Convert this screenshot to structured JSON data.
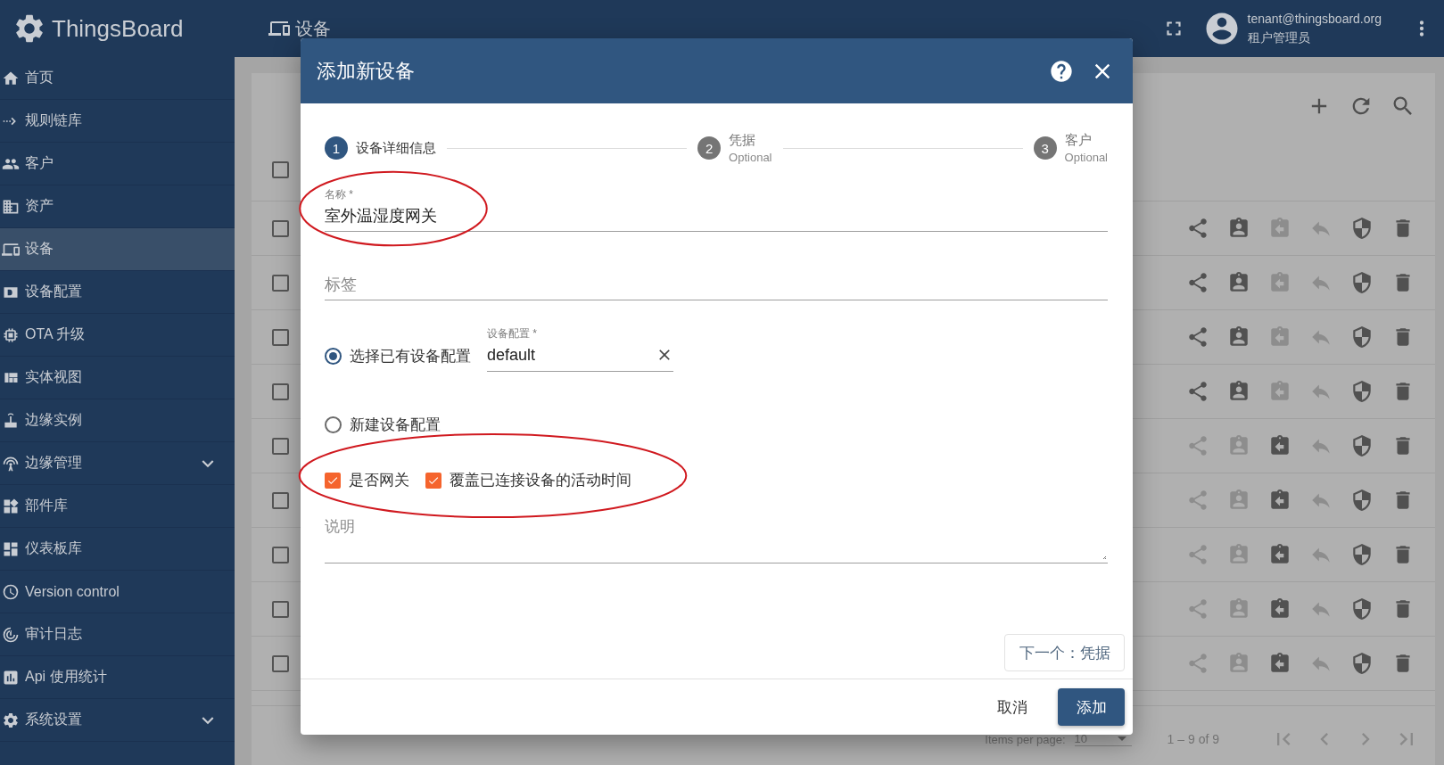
{
  "header": {
    "logo_text": "ThingsBoard",
    "page_title": "设备",
    "user_email": "tenant@thingsboard.org",
    "user_role": "租户管理员"
  },
  "sidebar": {
    "items": [
      {
        "label": "首页",
        "selected": false,
        "has_submenu": false
      },
      {
        "label": "规则链库",
        "selected": false,
        "has_submenu": false
      },
      {
        "label": "客户",
        "selected": false,
        "has_submenu": false
      },
      {
        "label": "资产",
        "selected": false,
        "has_submenu": false
      },
      {
        "label": "设备",
        "selected": true,
        "has_submenu": false
      },
      {
        "label": "设备配置",
        "selected": false,
        "has_submenu": false
      },
      {
        "label": "OTA 升级",
        "selected": false,
        "has_submenu": false
      },
      {
        "label": "实体视图",
        "selected": false,
        "has_submenu": false
      },
      {
        "label": "边缘实例",
        "selected": false,
        "has_submenu": false
      },
      {
        "label": "边缘管理",
        "selected": false,
        "has_submenu": true
      },
      {
        "label": "部件库",
        "selected": false,
        "has_submenu": false
      },
      {
        "label": "仪表板库",
        "selected": false,
        "has_submenu": false
      },
      {
        "label": "Version control",
        "selected": false,
        "has_submenu": false
      },
      {
        "label": "审计日志",
        "selected": false,
        "has_submenu": false
      },
      {
        "label": "Api 使用统计",
        "selected": false,
        "has_submenu": false
      },
      {
        "label": "系统设置",
        "selected": false,
        "has_submenu": true
      }
    ]
  },
  "device_table": {
    "header_checked": false,
    "rows": [
      {
        "checked": false,
        "assigned": false
      },
      {
        "checked": false,
        "assigned": false
      },
      {
        "checked": false,
        "assigned": false
      },
      {
        "checked": false,
        "assigned": false
      },
      {
        "checked": false,
        "assigned": true
      },
      {
        "checked": false,
        "assigned": true
      },
      {
        "checked": false,
        "assigned": true
      },
      {
        "checked": false,
        "assigned": true
      },
      {
        "checked": false,
        "assigned": true
      }
    ],
    "pagination": {
      "items_per_page_label": "Items per page:",
      "page_size": "10",
      "range": "1 – 9 of 9"
    }
  },
  "dialog": {
    "title": "添加新设备",
    "steps": [
      {
        "number": "1",
        "label": "设备详细信息",
        "selected": true
      },
      {
        "number": "2",
        "label": "凭据",
        "sublabel": "Optional",
        "selected": false
      },
      {
        "number": "3",
        "label": "客户",
        "sublabel": "Optional",
        "selected": false
      }
    ],
    "name_field": {
      "label": "名称 *",
      "value": "室外温湿度网关"
    },
    "label_field": {
      "placeholder": "标签"
    },
    "profile_options": [
      {
        "label": "选择已有设备配置",
        "selected": true
      },
      {
        "label": "新建设备配置",
        "selected": false
      }
    ],
    "profile_field": {
      "label": "设备配置 *",
      "value": "default"
    },
    "checkboxes": [
      {
        "label": "是否网关",
        "checked": true
      },
      {
        "label": "覆盖已连接设备的活动时间",
        "checked": true
      }
    ],
    "description_field": {
      "placeholder": "说明"
    },
    "next_button": "下一个：凭据",
    "cancel_button": "取消",
    "add_button": "添加"
  },
  "annotations": [
    {
      "kind": "ellipse"
    },
    {
      "kind": "ellipse"
    }
  ]
}
